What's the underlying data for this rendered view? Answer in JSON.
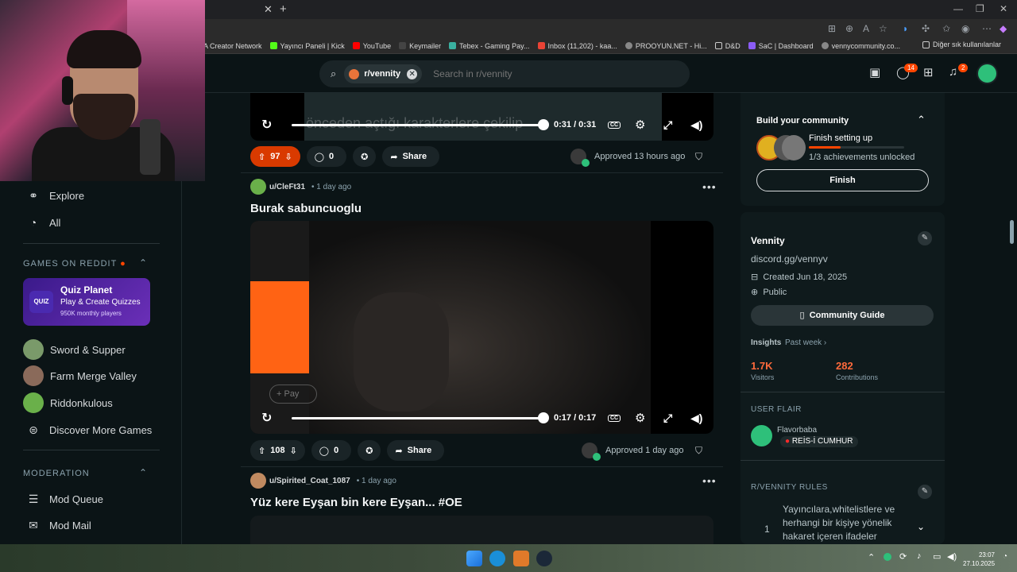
{
  "browser": {
    "bookmarks": [
      "A Creator Network",
      "Yayıncı Paneli | Kick",
      "YouTube",
      "Keymailer",
      "Tebex - Gaming Pay...",
      "Inbox (11,202) - kaa...",
      "PROOYUN.NET - Hi...",
      "D&D",
      "SaC | Dashboard",
      "vennycommunity.co..."
    ],
    "other_bookmarks": "Diğer sık kullanılanlar"
  },
  "header": {
    "search_chip": "r/vennity",
    "search_placeholder": "Search in r/vennity",
    "chat_badge": "14",
    "notif_badge": "2"
  },
  "sidebar": {
    "explore": "Explore",
    "all": "All",
    "games_title": "GAMES ON REDDIT",
    "quiz": {
      "logo": "QUIZ",
      "title": "Quiz Planet",
      "subtitle": "Play & Create Quizzes",
      "players": "950K monthly players"
    },
    "games": [
      "Sword & Supper",
      "Farm Merge Valley",
      "Riddonkulous"
    ],
    "discover": "Discover More Games",
    "moderation_title": "MODERATION",
    "mod_queue": "Mod Queue",
    "mod_mail": "Mod Mail"
  },
  "feed": {
    "post0": {
      "time": "0:31 / 0:31",
      "subtitle": "önceden açtığı karakterlere çekilip",
      "votes": "97",
      "comments": "0",
      "share": "Share",
      "approved": "Approved 13 hours ago"
    },
    "post1": {
      "user": "u/CleFt31",
      "age": "• 1 day ago",
      "title": "Burak sabuncuoglu",
      "time": "0:17 / 0:17",
      "votes": "108",
      "comments": "0",
      "share": "Share",
      "approved": "Approved 1 day ago"
    },
    "post2": {
      "user": "u/Spirited_Coat_1087",
      "age": "• 1 day ago",
      "title": "Yüz kere Eyşan bin kere Eyşan... #OE"
    }
  },
  "right": {
    "build": {
      "title": "Build your community",
      "setup": "Finish setting up",
      "progress": "1/3 achievements unlocked",
      "progress_value": 0.33,
      "finish": "Finish"
    },
    "about": {
      "name": "Vennity",
      "link": "discord.gg/vennyv",
      "created": "Created Jun 18, 2025",
      "visibility": "Public",
      "guide": "Community Guide"
    },
    "insights": {
      "label": "Insights",
      "range": "Past week",
      "visitors_value": "1.7K",
      "visitors_label": "Visitors",
      "contrib_value": "282",
      "contrib_label": "Contributions"
    },
    "flair": {
      "title": "USER FLAIR",
      "user": "Flavorbaba",
      "flair": "REİS-İ CUMHUR"
    },
    "rules": {
      "title": "R/VENNITY RULES",
      "rule1_num": "1",
      "rule1_text": "Yayıncılara,whitelistlere ve herhangi bir kişiye yönelik hakaret içeren ifadeler"
    }
  },
  "taskbar": {
    "time": "23:07",
    "date": "27.10.2025"
  }
}
